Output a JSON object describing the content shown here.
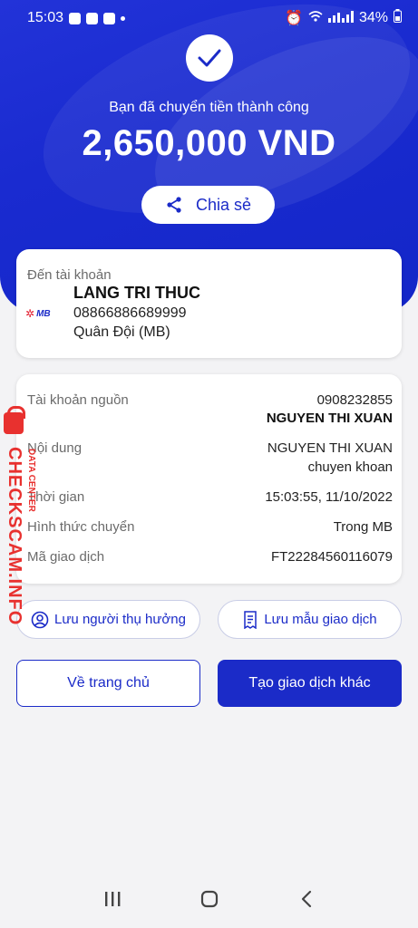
{
  "status_bar": {
    "time": "15:03",
    "battery": "34%"
  },
  "success": {
    "message": "Bạn đã chuyển tiền thành công",
    "amount": "2,650,000 VND",
    "share_label": "Chia sẻ"
  },
  "destination": {
    "label": "Đến tài khoản",
    "bank_logo_text": "MB",
    "name": "LANG TRI THUC",
    "account_number": "08866886689999",
    "bank_name": "Quân Đội (MB)"
  },
  "details": {
    "source_account_label": "Tài khoản nguồn",
    "source_account_number": "0908232855",
    "source_account_name": "NGUYEN THI XUAN",
    "content_label": "Nội dung",
    "content_line1": "NGUYEN THI XUAN",
    "content_line2": "chuyen khoan",
    "time_label": "Thời gian",
    "time_value": "15:03:55, 11/10/2022",
    "method_label": "Hình thức chuyển",
    "method_value": "Trong MB",
    "transaction_id_label": "Mã giao dịch",
    "transaction_id_value": "FT22284560116079"
  },
  "watermark": {
    "main": "CHECKSCAM.INFO",
    "sub": "DATA CENTER"
  },
  "actions": {
    "save_beneficiary": "Lưu người thụ hưởng",
    "save_template": "Lưu mẫu giao dịch",
    "home": "Về trang chủ",
    "new_transaction": "Tạo giao dịch khác"
  },
  "colors": {
    "primary": "#1b2bc8",
    "watermark": "#e8312f"
  },
  "icons": [
    "check-icon",
    "share-icon",
    "user-circle-icon",
    "receipt-icon",
    "recent-apps-icon",
    "home-icon",
    "back-icon"
  ]
}
